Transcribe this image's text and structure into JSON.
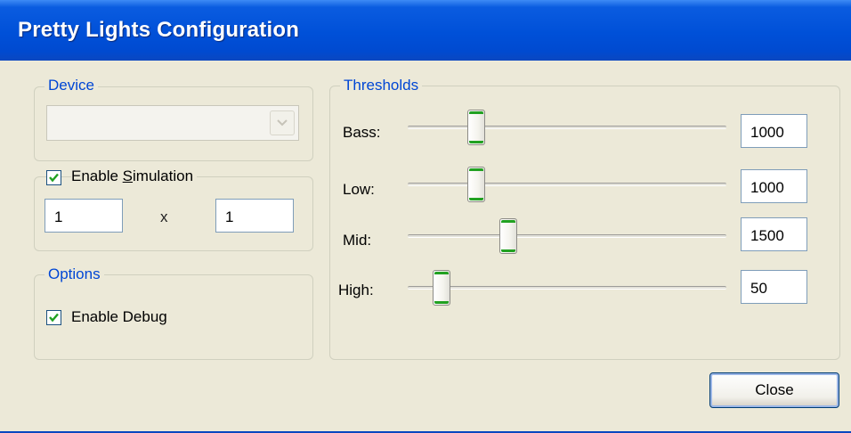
{
  "window": {
    "title": "Pretty Lights Configuration"
  },
  "device": {
    "legend": "Device",
    "selected": ""
  },
  "simulation": {
    "label": "Enable Simulation",
    "label_pre": "Enable ",
    "label_accel": "S",
    "label_post": "imulation",
    "checked": true,
    "width_value": "1",
    "separator": "x",
    "height_value": "1"
  },
  "options": {
    "legend": "Options",
    "debug_label": "Enable Debug",
    "debug_checked": true
  },
  "thresholds": {
    "legend": "Thresholds",
    "sliders": [
      {
        "label": "Bass:",
        "value": "1000",
        "level": 0.21
      },
      {
        "label": "Low:",
        "value": "1000",
        "level": 0.21
      },
      {
        "label": "Mid:",
        "value": "1500",
        "level": 0.31
      },
      {
        "label": "High:",
        "value": "50",
        "level": 0.1
      }
    ]
  },
  "close_label": "Close",
  "colors": {
    "accent": "#0046D5",
    "titlebar": "#0050D8",
    "check": "#21A121"
  }
}
